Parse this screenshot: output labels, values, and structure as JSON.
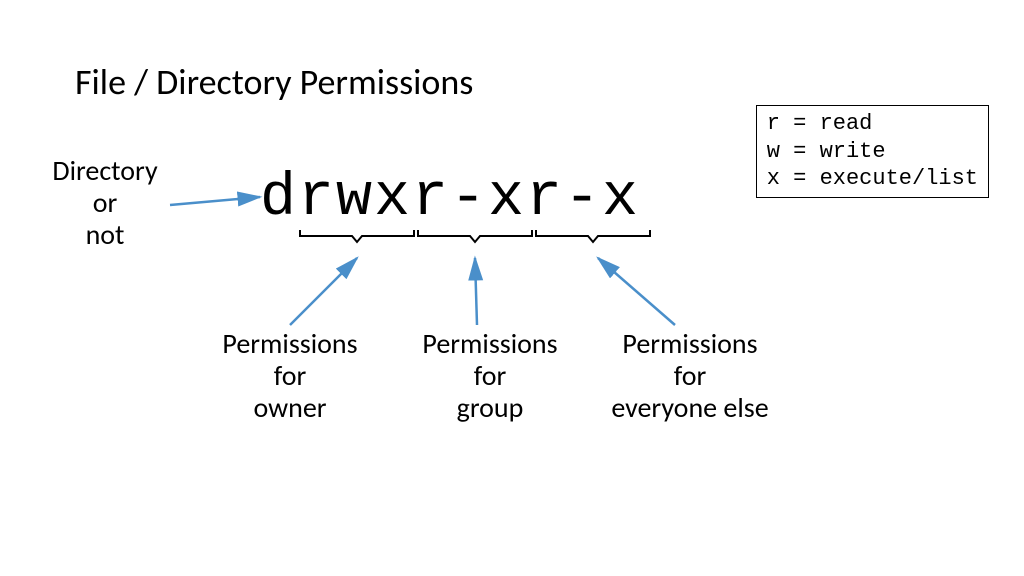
{
  "title": "File / Directory Permissions",
  "legend": {
    "line1": "r = read",
    "line2": "w = write",
    "line3": "x = execute/list"
  },
  "directory_label": {
    "line1": "Directory",
    "line2": "or",
    "line3": "not"
  },
  "permission_string": "drwxr-xr-x",
  "labels": {
    "owner": {
      "line1": "Permissions",
      "line2": "for",
      "line3": "owner"
    },
    "group": {
      "line1": "Permissions",
      "line2": "for",
      "line3": "group"
    },
    "everyone": {
      "line1": "Permissions",
      "line2": "for",
      "line3": "everyone else"
    }
  },
  "colors": {
    "arrow": "#4A8FCA"
  }
}
